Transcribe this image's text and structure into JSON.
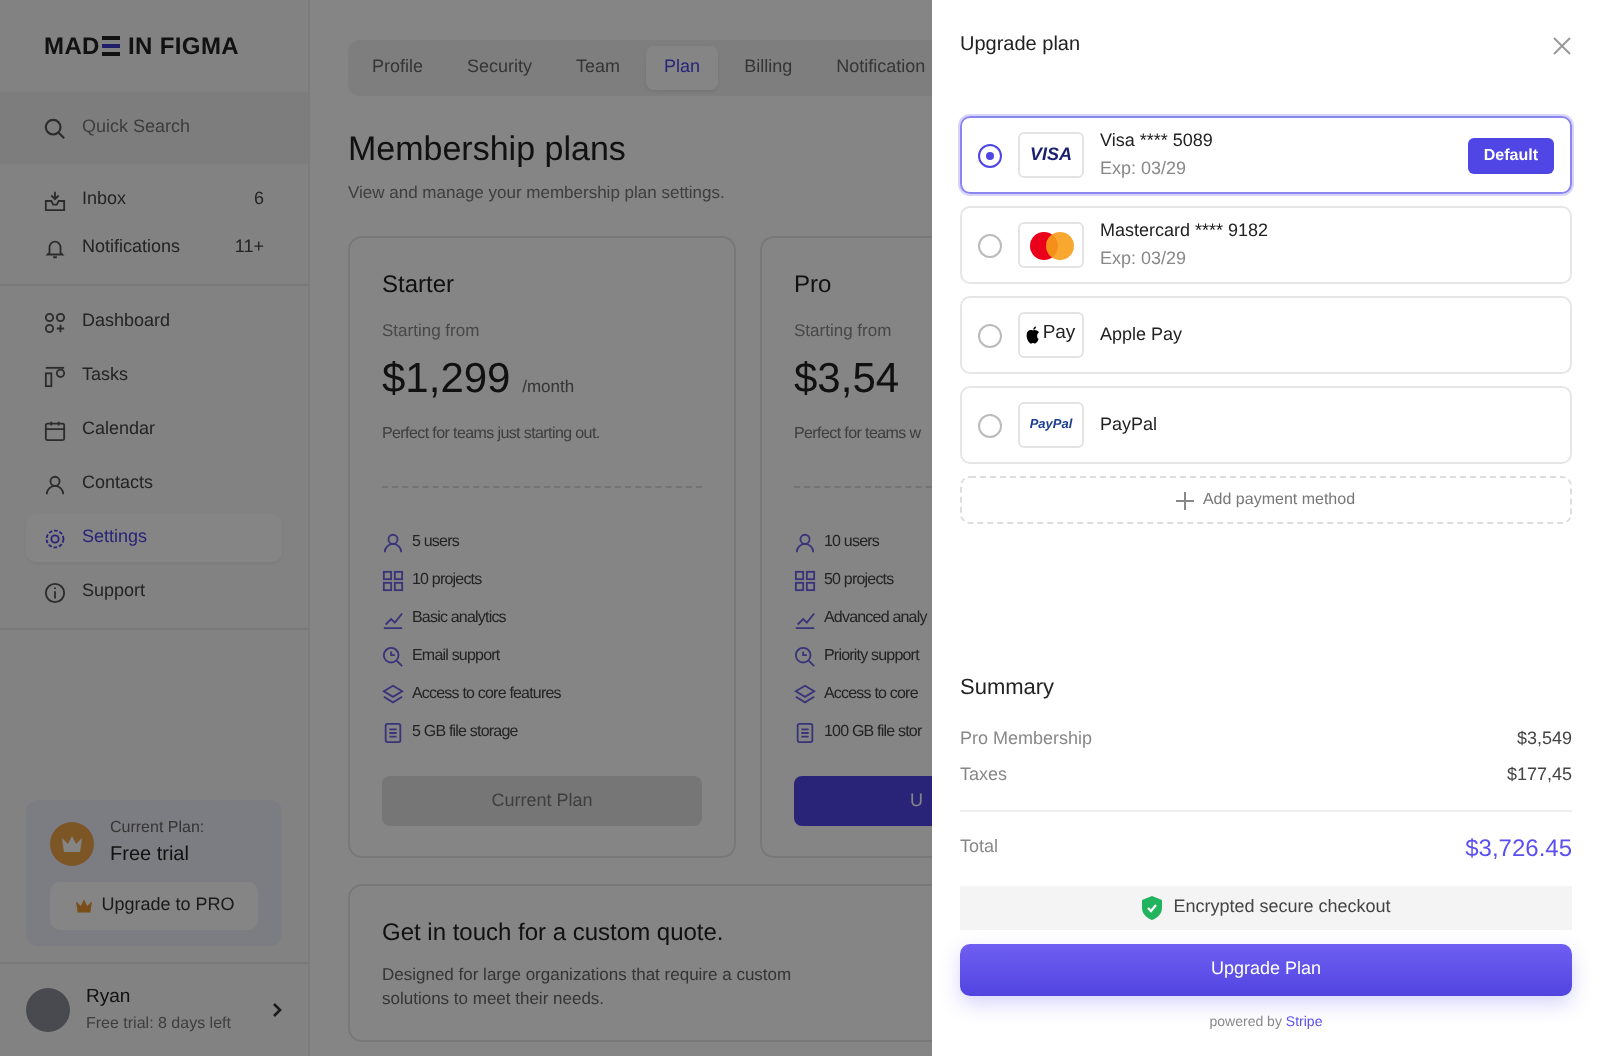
{
  "brand": {
    "before": "MAD",
    "after": "IN FIGMA"
  },
  "sidebar": {
    "search": {
      "placeholder": "Quick Search"
    },
    "top_items": [
      {
        "label": "Inbox",
        "count": "6",
        "selected": false
      },
      {
        "label": "Notifications",
        "count": "11+",
        "selected": false
      }
    ],
    "items": [
      {
        "label": "Dashboard",
        "selected": false
      },
      {
        "label": "Tasks",
        "selected": false
      },
      {
        "label": "Calendar",
        "selected": false
      },
      {
        "label": "Contacts",
        "selected": false
      },
      {
        "label": "Settings",
        "selected": true
      },
      {
        "label": "Support",
        "selected": false
      }
    ],
    "plan_card": {
      "caption": "Current Plan:",
      "plan": "Free trial",
      "button": "Upgrade to PRO"
    },
    "user": {
      "name": "Ryan",
      "status": "Free trial: 8 days left"
    }
  },
  "tabs": [
    {
      "label": "Profile",
      "selected": false
    },
    {
      "label": "Security",
      "selected": false
    },
    {
      "label": "Team",
      "selected": false
    },
    {
      "label": "Plan",
      "selected": true
    },
    {
      "label": "Billing",
      "selected": false
    },
    {
      "label": "Notification",
      "selected": false
    }
  ],
  "page": {
    "title": "Membership plans",
    "subtitle": "View and manage your membership plan settings."
  },
  "plans": [
    {
      "name": "Starter",
      "from": "Starting from",
      "price": "$1,299",
      "period": "/month",
      "desc": "Perfect for teams just starting out.",
      "features": [
        "5 users",
        "10 projects",
        "Basic analytics",
        "Email support",
        "Access to core features",
        "5 GB file storage"
      ],
      "button": "Current Plan",
      "current": true
    },
    {
      "name": "Pro",
      "from": "Starting from",
      "price": "$3,54",
      "desc": "Perfect for teams w",
      "features": [
        "10 users",
        "50 projects",
        "Advanced analy",
        "Priority support",
        "Access to core",
        "100 GB file stor"
      ],
      "button": "U",
      "current": false
    }
  ],
  "custom_quote": {
    "title": "Get in touch for a custom quote.",
    "text": "Designed for large organizations that require a custom solutions to meet their needs."
  },
  "panel": {
    "title": "Upgrade plan",
    "methods": [
      {
        "name": "Visa **** 5089",
        "expiry": "Exp: 03/29",
        "logo": "VISA",
        "badge": "Default",
        "selected": true
      },
      {
        "name": "Mastercard **** 9182",
        "expiry": "Exp: 03/29",
        "selected": false
      },
      {
        "name": "Apple Pay",
        "logo": "Pay",
        "selected": false
      },
      {
        "name": "PayPal",
        "logo": "PayPal",
        "selected": false
      }
    ],
    "add_method": "Add payment method",
    "summary": {
      "title": "Summary",
      "lines": [
        {
          "label": "Pro Membership",
          "value": "$3,549"
        },
        {
          "label": "Taxes",
          "value": "$177,45"
        }
      ],
      "total_label": "Total",
      "total": "$3,726.45"
    },
    "secure": "Encrypted secure checkout",
    "button": "Upgrade Plan",
    "powered": "powered by",
    "provider": "Stripe"
  }
}
